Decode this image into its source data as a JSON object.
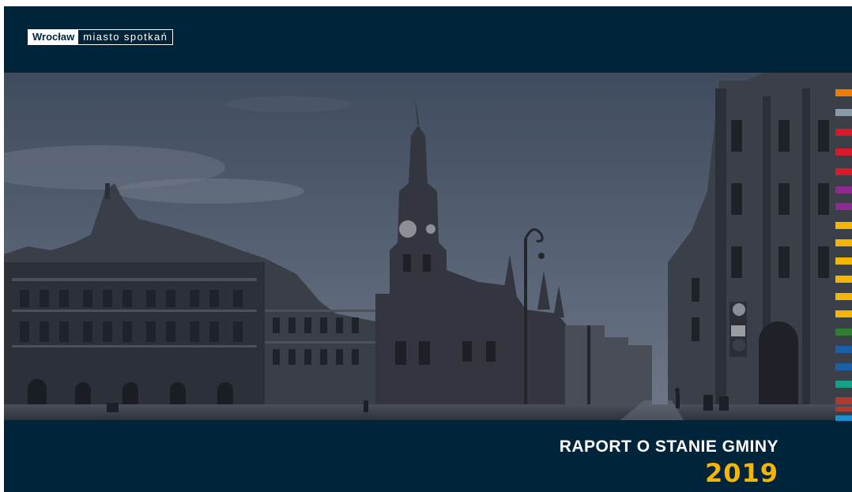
{
  "logo": {
    "city": "Wrocław",
    "slogan": "miasto spotkań"
  },
  "report": {
    "title": "RAPORT O STANIE GMINY",
    "year": "2019"
  },
  "colors": {
    "background": "#00243a",
    "year": "#f5b600",
    "strip": [
      "#f07d00",
      "#8a9ba8",
      "#d7192a",
      "#d7192a",
      "#d7192a",
      "#8f2a8f",
      "#8f2a8f",
      "#f5b600",
      "#f5b600",
      "#f5b600",
      "#f5b600",
      "#f5b600",
      "#f5b600",
      "#2e7d32",
      "#1b5fa8",
      "#1b5fa8",
      "#16a087",
      "#b03a2e",
      "#b03a2e",
      "#1d8fd0"
    ]
  },
  "photo": {
    "subject": "wroclaw-market-square-town-hall"
  }
}
